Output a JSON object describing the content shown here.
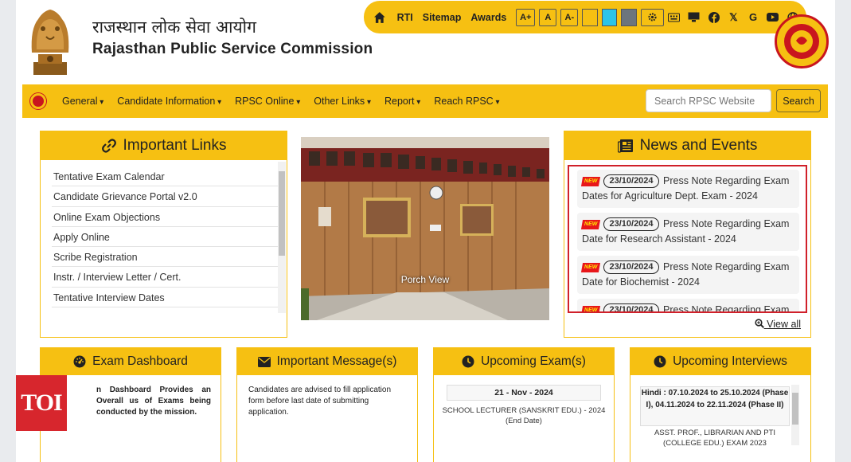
{
  "header": {
    "title_hindi": "राजस्थान लोक सेवा आयोग",
    "title_english": "Rajasthan Public Service Commission"
  },
  "topbar": {
    "links": [
      "RTI",
      "Sitemap",
      "Awards"
    ],
    "font_buttons": [
      "A+",
      "A",
      "A-"
    ],
    "theme_swatches": [
      "#f6c012",
      "#2cc4e8",
      "#6c757d"
    ],
    "social_icons": [
      "keyboard-icon",
      "monitor-icon",
      "facebook-icon",
      "x-icon",
      "google-icon",
      "youtube-icon",
      "globe-icon"
    ]
  },
  "nav": {
    "items": [
      "General",
      "Candidate Information",
      "RPSC Online",
      "Other Links",
      "Report",
      "Reach RPSC"
    ],
    "search_placeholder": "Search RPSC Website",
    "search_button": "Search"
  },
  "important_links": {
    "title": "Important Links",
    "items": [
      "Tentative Exam Calendar",
      "Candidate Grievance Portal v2.0",
      "Online Exam Objections",
      "Apply Online",
      "Scribe Registration",
      "Instr. / Interview Letter / Cert.",
      "Tentative Interview Dates"
    ]
  },
  "carousel": {
    "caption": "Porch View"
  },
  "news": {
    "title": "News and Events",
    "badge": "NEW",
    "items": [
      {
        "date": "23/10/2024",
        "text": "Press Note Regarding Exam Dates for Agriculture Dept. Exam - 2024"
      },
      {
        "date": "23/10/2024",
        "text": "Press Note Regarding Exam Date for Research Assistant - 2024"
      },
      {
        "date": "23/10/2024",
        "text": "Press Note Regarding Exam Date for Biochemist - 2024"
      },
      {
        "date": "23/10/2024",
        "text": "Press Note Regarding Exam Date"
      }
    ],
    "view_all": "View all"
  },
  "cards": {
    "exam_dashboard": {
      "title": "Exam Dashboard",
      "body": "n Dashboard Provides an Overall us of Exams being conducted by the mission."
    },
    "important_message": {
      "title": "Important Message(s)",
      "body": "Candidates are advised to fill application form before last date of submitting application."
    },
    "upcoming_exams": {
      "title": "Upcoming Exam(s)",
      "date": "21 - Nov - 2024",
      "desc": "SCHOOL LECTURER (SANSKRIT EDU.) - 2024 (End Date)"
    },
    "upcoming_interviews": {
      "title": "Upcoming Interviews",
      "schedule": "Hindi : 07.10.2024 to 25.10.2024 (Phase I), 04.11.2024 to 22.11.2024 (Phase II)",
      "next": "ASST. PROF., LIBRARIAN AND PTI (COLLEGE EDU.) EXAM 2023"
    }
  },
  "watermark": {
    "text": "TOI"
  },
  "colors": {
    "accent": "#f6c012",
    "highlight_border": "#d0202a"
  }
}
